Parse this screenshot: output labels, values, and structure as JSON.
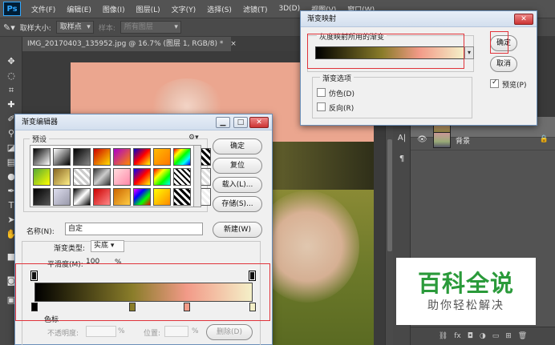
{
  "app": {
    "logo": "Ps",
    "menu": [
      "文件(F)",
      "编辑(E)",
      "图像(I)",
      "图层(L)",
      "文字(Y)",
      "选择(S)",
      "滤镜(T)",
      "3D(D)",
      "视图(V)",
      "窗口(W)"
    ]
  },
  "options_bar": {
    "sample_size_label": "取样大小:",
    "sample_size_value": "取样点",
    "sample_label": "样本:",
    "sample_value": "所有图层"
  },
  "document_tab": {
    "title": "IMG_20170403_135952.jpg @ 16.7% (图层 1, RGB/8) *",
    "close": "×"
  },
  "gradient_map": {
    "title": "渐变映射",
    "group_label": "灰度映射所用的渐变",
    "ok_button": "确定",
    "cancel_button": "取消",
    "preview_label": "预览(P)",
    "preview_checked": true,
    "options_label": "渐变选项",
    "dither_label": "仿色(D)",
    "reverse_label": "反向(R)"
  },
  "gradient_editor": {
    "title": "渐变编辑器",
    "presets_label": "预设",
    "ok_button": "确定",
    "reset_button": "复位",
    "load_button": "载入(L)...",
    "save_button": "存储(S)...",
    "name_label": "名称(N):",
    "name_value": "自定",
    "new_button": "新建(W)",
    "type_label": "渐变类型:",
    "type_value": "实底",
    "smooth_label": "平滑度(M):",
    "smooth_value": "100",
    "smooth_unit": "%",
    "stops_label": "色标",
    "opacity_label": "不透明度:",
    "opacity_unit": "%",
    "location_label": "位置:",
    "location_unit": "%",
    "delete_button": "删除(D)"
  },
  "gradient_colors": {
    "stops": [
      "#000000",
      "#8a7d2a",
      "#f29a88",
      "#f4f0c8"
    ],
    "stop_positions_pct": [
      0,
      45,
      70,
      100
    ]
  },
  "layers": {
    "items": [
      {
        "name": "背景",
        "locked": true
      }
    ]
  },
  "panel_strip": [
    "A|",
    "¶"
  ],
  "watermark": {
    "title": "百科全说",
    "subtitle": "助你轻松解决"
  }
}
